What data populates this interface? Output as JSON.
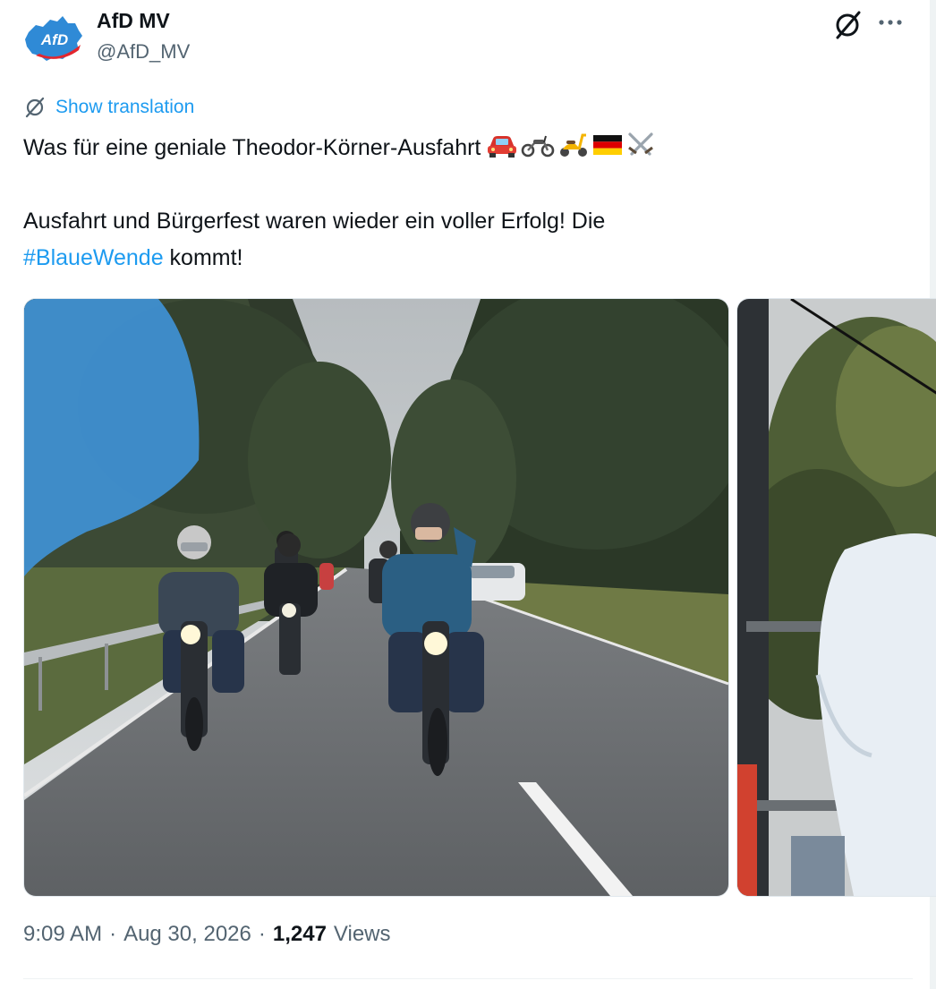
{
  "author": {
    "name": "AfD MV",
    "handle": "@AfD_MV",
    "avatar_text": "AfD",
    "brand_color": "#2f8ad6"
  },
  "actions": {
    "grok_icon": "grok-icon",
    "more_icon": "more-horizontal-icon"
  },
  "translate": {
    "label": "Show translation"
  },
  "tweet": {
    "line1": "Was für eine geniale Theodor-Körner-Ausfahrt",
    "line1_emojis": [
      "car-emoji",
      "motorcycle-emoji",
      "scooter-emoji",
      "german-flag-emoji",
      "crossed-swords-emoji"
    ],
    "line2_start": "Ausfahrt und Bürgerfest waren wieder ein voller Erfolg! Die",
    "hashtag": "#BlaueWende",
    "line3_end": " kommt!"
  },
  "media": [
    {
      "name": "photo-motorcycle-ride"
    },
    {
      "name": "photo-person-white-jacket"
    }
  ],
  "meta": {
    "time": "9:09 AM",
    "date": "Aug 30, 2026",
    "views_count": "1,247",
    "views_label": "Views",
    "separator": "·"
  }
}
